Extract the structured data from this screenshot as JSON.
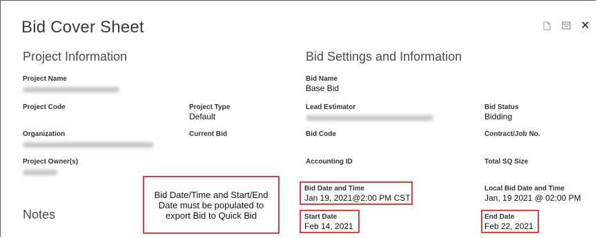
{
  "header": {
    "title": "Bid Cover Sheet",
    "icons": [
      "document-icon",
      "print-icon",
      "close-icon"
    ],
    "close_label": "✕"
  },
  "project_info": {
    "heading": "Project Information",
    "project_name": {
      "label": "Project Name"
    },
    "project_code": {
      "label": "Project Code"
    },
    "project_type": {
      "label": "Project Type",
      "value": "Default"
    },
    "organization": {
      "label": "Organization"
    },
    "current_bid": {
      "label": "Current Bid"
    },
    "project_owners": {
      "label": "Project Owner(s)"
    }
  },
  "notes": {
    "heading": "Notes"
  },
  "bid_settings": {
    "heading": "Bid Settings and Information",
    "bid_name": {
      "label": "Bid Name",
      "value": "Base Bid"
    },
    "lead_estimator": {
      "label": "Lead Estimator"
    },
    "bid_status": {
      "label": "Bid Status",
      "value": "Bidding"
    },
    "bid_code": {
      "label": "Bid Code"
    },
    "contract_job_no": {
      "label": "Contract/Job No."
    },
    "accounting_id": {
      "label": "Accounting ID"
    },
    "total_sq_size": {
      "label": "Total SQ Size"
    },
    "bid_date_time": {
      "label": "Bid Date and Time",
      "value": "Jan 19, 2021@2:00 PM CST"
    },
    "local_bid_date_time": {
      "label": "Local Bid Date and Time",
      "value": "Jan, 19 2021 @ 02:00 PM"
    },
    "start_date": {
      "label": "Start Date",
      "value": "Feb 14, 2021"
    },
    "end_date": {
      "label": "End Date",
      "value": "Feb 22, 2021"
    }
  },
  "callout": {
    "text": "Bid Date/Time and Start/End Date must be populated to export Bid to Quick Bid"
  },
  "colors": {
    "highlight": "#e04040",
    "blurred_text": "#c8c8c8"
  }
}
